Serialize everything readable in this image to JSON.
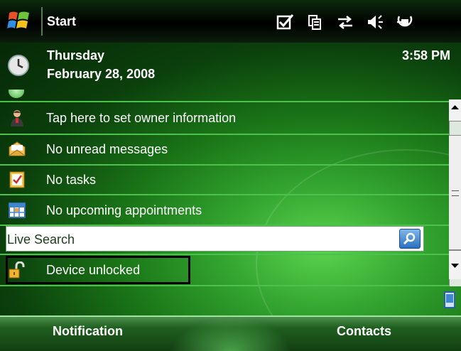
{
  "titlebar": {
    "start_label": "Start",
    "status_icons": [
      "connectivity-check-icon",
      "battery-copy-icon",
      "data-transfer-icon",
      "volume-icon",
      "power-plug-icon"
    ]
  },
  "today": {
    "day": "Thursday",
    "date": "February 28, 2008",
    "time": "3:58 PM",
    "items": [
      {
        "label": "Tap here to set owner information",
        "icon": "owner-person-icon"
      },
      {
        "label": "No unread messages",
        "icon": "envelope-icon"
      },
      {
        "label": "No tasks",
        "icon": "tasks-clipboard-icon"
      },
      {
        "label": "No upcoming appointments",
        "icon": "calendar-icon"
      }
    ],
    "search": {
      "label": "Live Search",
      "button_icon": "search-magnifier-icon"
    },
    "lock_status": {
      "label": "Device unlocked",
      "icon": "padlock-open-icon"
    }
  },
  "softkeys": {
    "left": "Notification",
    "right": "Contacts"
  },
  "colors": {
    "accent_green": "#4cc24c",
    "titlebar_bg": "#000000",
    "search_button": "#2a6fc0"
  }
}
